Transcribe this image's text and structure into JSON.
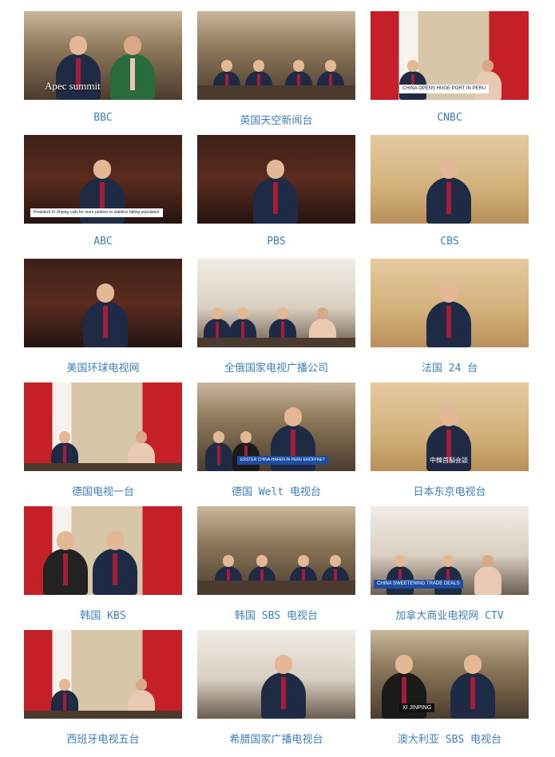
{
  "thumbnails": [
    {
      "caption": "BBC",
      "overlay": "Apec summit",
      "banner": ""
    },
    {
      "caption": "英国天空新闻台",
      "overlay": "",
      "banner": ""
    },
    {
      "caption": "CNBC",
      "overlay": "",
      "banner": "CHINA OPENS HUGE PORT IN PERU"
    },
    {
      "caption": "ABC",
      "overlay": "",
      "banner": "President Xi Jinping calls for more policies to stabilize falling population"
    },
    {
      "caption": "PBS",
      "overlay": "",
      "banner": ""
    },
    {
      "caption": "CBS",
      "overlay": "",
      "banner": ""
    },
    {
      "caption": "美国环球电视网",
      "overlay": "",
      "banner": ""
    },
    {
      "caption": "全俄国家电视广播公司",
      "overlay": "",
      "banner": ""
    },
    {
      "caption": "法国 24 台",
      "overlay": "",
      "banner": ""
    },
    {
      "caption": "德国电视一台",
      "overlay": "",
      "banner": ""
    },
    {
      "caption": "德国 Welt 电视台",
      "overlay": "",
      "banner": "ERSTER CHINA-HAFEN IN PERU ERÖFFNET"
    },
    {
      "caption": "日本东京电视台",
      "overlay": "",
      "banner": "中韓首脳会談"
    },
    {
      "caption": "韩国 KBS",
      "overlay": "",
      "banner": ""
    },
    {
      "caption": "韩国 SBS 电视台",
      "overlay": "",
      "banner": ""
    },
    {
      "caption": "加拿大商业电视网 CTV",
      "overlay": "",
      "banner": "CHINA SWEETENING TRADE DEALS"
    },
    {
      "caption": "西班牙电视五台",
      "overlay": "",
      "banner": ""
    },
    {
      "caption": "希腊国家广播电视台",
      "overlay": "",
      "banner": ""
    },
    {
      "caption": "澳大利亚 SBS 电视台",
      "overlay": "",
      "banner": "XI JINPING"
    }
  ]
}
